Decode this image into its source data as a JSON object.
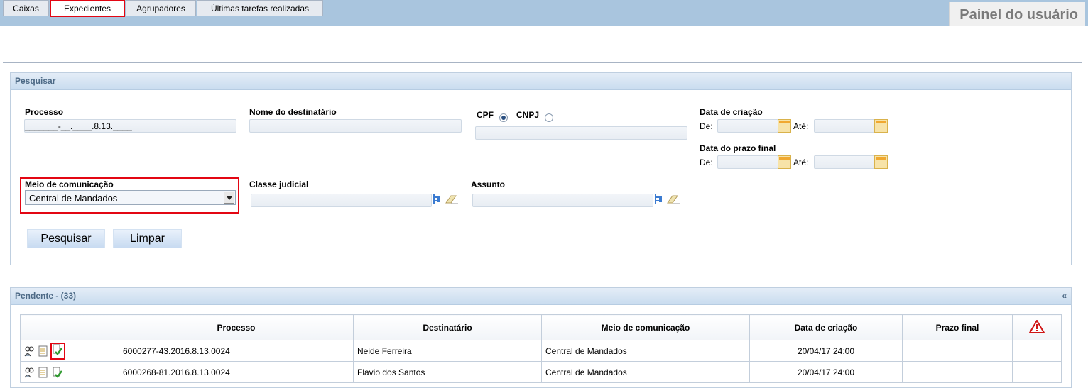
{
  "page": {
    "title": "Painel do usuário"
  },
  "tabs": [
    {
      "label": "Caixas"
    },
    {
      "label": "Expedientes"
    },
    {
      "label": "Agrupadores"
    },
    {
      "label": "Últimas tarefas realizadas"
    }
  ],
  "search": {
    "header": "Pesquisar",
    "processo_label": "Processo",
    "processo_value": "_______-__.____.8.13.____",
    "nome_label": "Nome do destinatário",
    "cpf_label": "CPF",
    "cnpj_label": "CNPJ",
    "data_criacao_label": "Data de criação",
    "de_label": "De:",
    "ate_label": "Até:",
    "data_prazo_label": "Data do prazo final",
    "meio_label": "Meio de comunicação",
    "meio_value": "Central de Mandados",
    "classe_label": "Classe judicial",
    "assunto_label": "Assunto",
    "pesquisar_button": "Pesquisar",
    "limpar_button": "Limpar"
  },
  "results": {
    "header": "Pendente - (33)",
    "collapse_symbol": "«",
    "columns": [
      "Processo",
      "Destinatário",
      "Meio de comunicação",
      "Data de criação",
      "Prazo final"
    ],
    "rows": [
      {
        "processo": "6000277-43.2016.8.13.0024",
        "destinatario": "Neide Ferreira",
        "meio": "Central de Mandados",
        "data": "20/04/17 24:00",
        "prazo": ""
      },
      {
        "processo": "6000268-81.2016.8.13.0024",
        "destinatario": "Flavio dos Santos",
        "meio": "Central de Mandados",
        "data": "20/04/17 24:00",
        "prazo": ""
      }
    ]
  },
  "colors": {
    "topbar": "#a9c5de",
    "highlight": "#e30613",
    "panel_header_text": "#4d6a86"
  },
  "icons": [
    "tree-icon",
    "eraser-icon",
    "calendar-icon",
    "warning-icon",
    "people-icon",
    "document-icon",
    "check-document-icon"
  ]
}
